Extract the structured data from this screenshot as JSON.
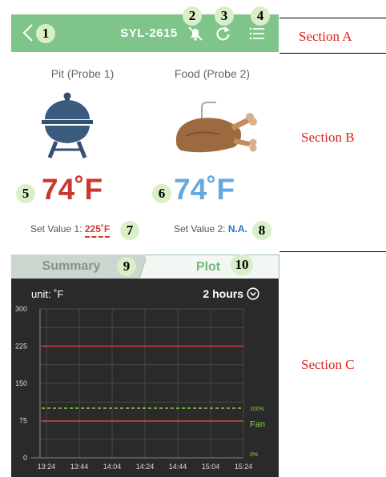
{
  "header": {
    "device_name": "SYL-2615",
    "icons": [
      "back-chevron-icon",
      "bell-muted-icon",
      "refresh-icon",
      "menu-icon"
    ],
    "accent": "#7fc48a"
  },
  "markers": [
    "1",
    "2",
    "3",
    "4",
    "5",
    "6",
    "7",
    "8",
    "9",
    "10"
  ],
  "section_labels": {
    "a": "Section A",
    "b": "Section B",
    "c": "Section C"
  },
  "probes": {
    "pit": {
      "title": "Pit (Probe 1)",
      "temp": "74˚F",
      "color": "#c8392f"
    },
    "food": {
      "title": "Food (Probe 2)",
      "temp": "74˚F",
      "color": "#66a8e0"
    }
  },
  "set_values": {
    "one": {
      "label": "Set Value 1:",
      "value": "225˚F"
    },
    "two": {
      "label": "Set Value 2:",
      "value": "N.A."
    }
  },
  "tabs": {
    "summary": "Summary",
    "plot": "Plot"
  },
  "plot": {
    "unit_label": "unit: ˚F",
    "time_range": "2 hours"
  },
  "chart_data": {
    "type": "line",
    "x": [
      "13:24",
      "13:44",
      "14:04",
      "14:24",
      "14:44",
      "15:04",
      "15:24"
    ],
    "ylim": [
      0,
      300
    ],
    "yticks": [
      0,
      75,
      150,
      225,
      300
    ],
    "grid": true,
    "right_axis": {
      "ticks": [
        "100%",
        "0%"
      ],
      "label": "Fan"
    },
    "series": [
      {
        "values": [
          225,
          225,
          225,
          225,
          225,
          225,
          225
        ],
        "color": "#d0403a",
        "style": "solid"
      },
      {
        "values": [
          74,
          74,
          74,
          74,
          74,
          74,
          74
        ],
        "color": "#d0403a",
        "style": "solid"
      },
      {
        "name": "Fan",
        "values": [
          100,
          100,
          100,
          100,
          100,
          100,
          100
        ],
        "unit": "%",
        "color": "#8ccf3a",
        "style": "dashed"
      }
    ]
  }
}
